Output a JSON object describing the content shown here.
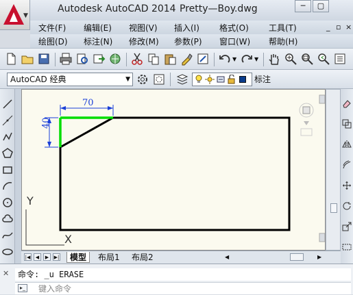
{
  "window": {
    "app_title": "Autodesk AutoCAD 2014",
    "file_name": "Pretty—Boy.dwg",
    "minimize_label": "─",
    "restore_label": "▢"
  },
  "menu": {
    "row1": [
      "文件(F)",
      "编辑(E)",
      "视图(V)",
      "插入(I)",
      "格式(O)",
      "工具(T)"
    ],
    "row2": [
      "绘图(D)",
      "标注(N)",
      "修改(M)",
      "参数(P)",
      "窗口(W)",
      "帮助(H)"
    ],
    "doc_controls": [
      "_",
      "▫",
      "×"
    ]
  },
  "toolbar": {
    "workspace": "AutoCAD 经典",
    "layer_name": "标注"
  },
  "drawing": {
    "dim_horizontal": "70",
    "dim_vertical": "40",
    "ucs_y": "Y",
    "ucs_x": "X",
    "colors": {
      "shape": "#000000",
      "highlight": "#00dd00",
      "dimension": "#1a3fd8",
      "background": "#fbfaef"
    }
  },
  "tabs": [
    "模型",
    "布局1",
    "布局2"
  ],
  "nav_buttons": [
    "|◀",
    "◀",
    "▶",
    "▶|"
  ],
  "command": {
    "history": "命令:  _u ERASE",
    "placeholder": "键入命令",
    "close_label": "✕",
    "icon_label": "▸_"
  }
}
